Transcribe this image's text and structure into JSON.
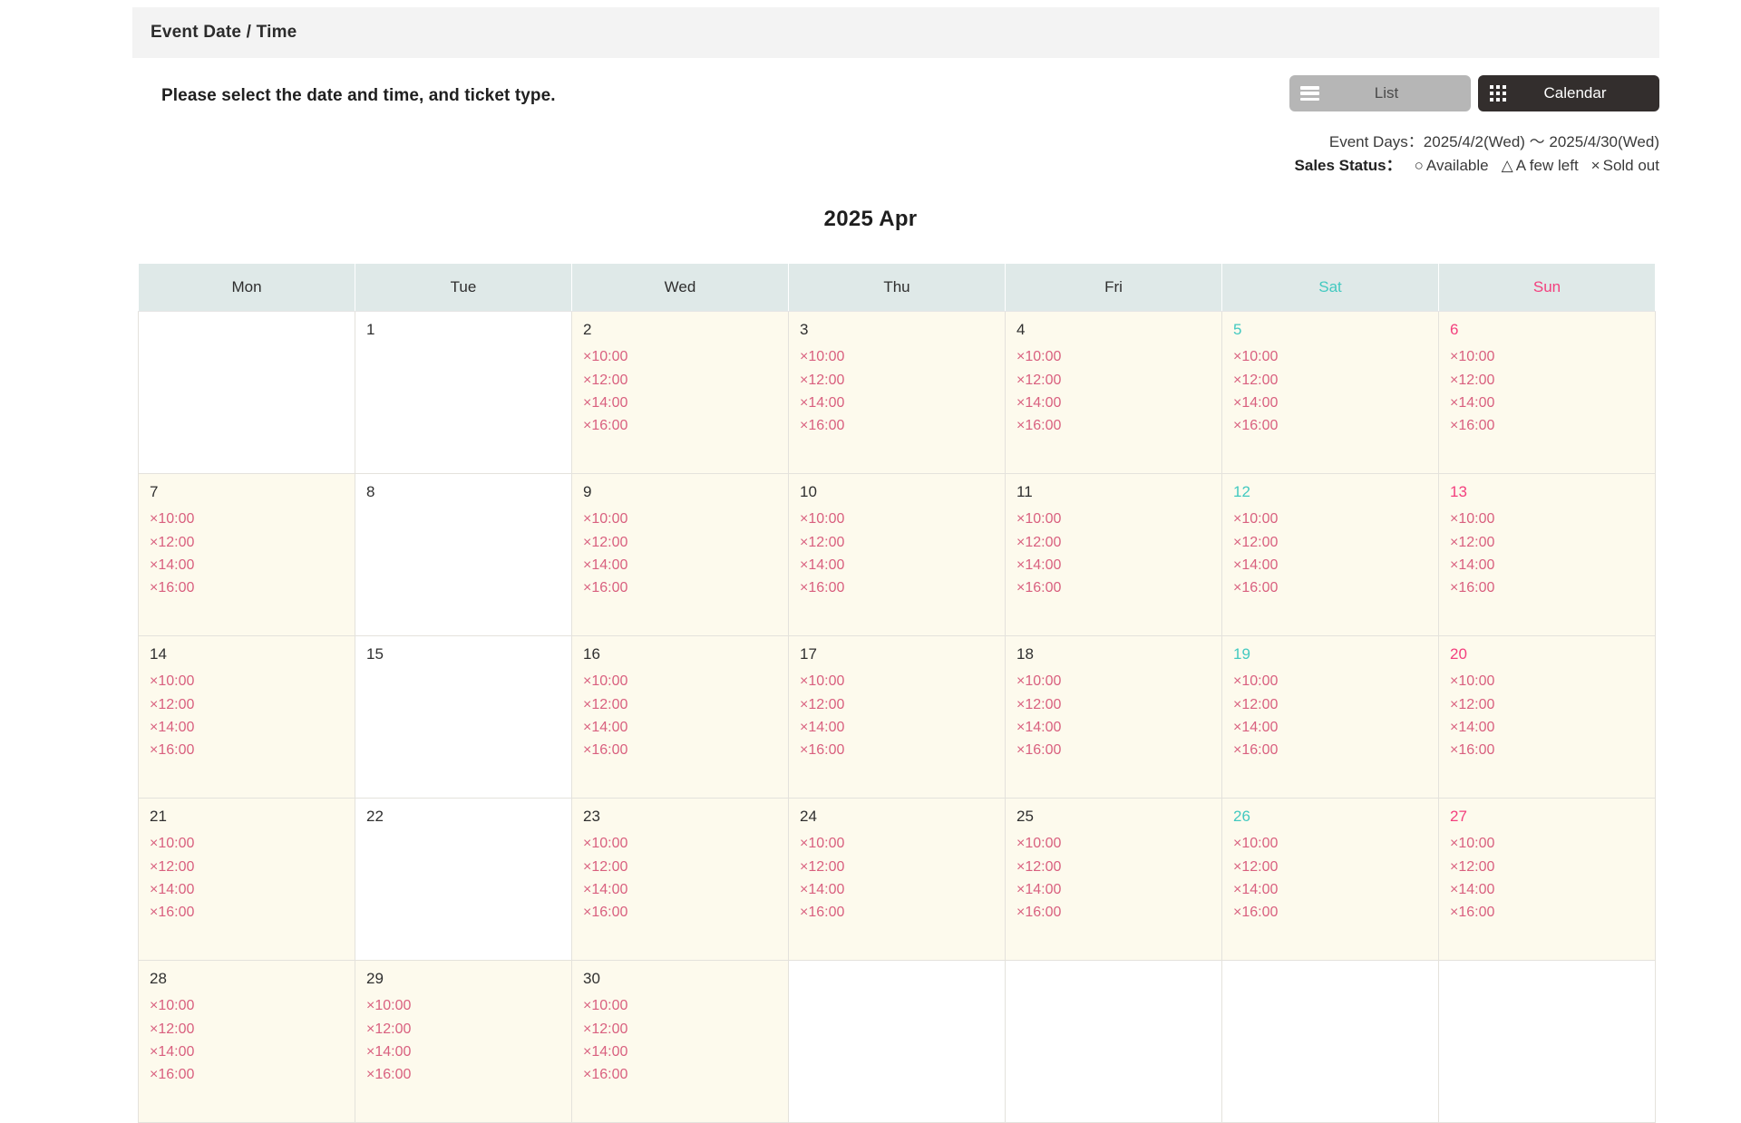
{
  "section": {
    "title": "Event Date / Time",
    "instruction": "Please select the date and time, and ticket type."
  },
  "view_toggle": {
    "list_label": "List",
    "calendar_label": "Calendar",
    "active": "Calendar",
    "list_icon": "hamburger-menu-icon",
    "calendar_icon": "grid-icon",
    "list_bg": "#b6b6b6",
    "calendar_bg": "#332e2d"
  },
  "meta": {
    "event_days_label": "Event Days",
    "event_days_separator": "：",
    "event_days_value": "2025/4/2(Wed) ～ 2025/4/30(Wed)",
    "sales_status_label": "Sales Status",
    "sales_status_separator": "：",
    "legend": [
      {
        "symbol": "○",
        "label": "Available"
      },
      {
        "symbol": "△",
        "label": "A few left"
      },
      {
        "symbol": "×",
        "label": "Sold out"
      }
    ]
  },
  "calendar": {
    "month_title": "2025 Apr",
    "weekdays": [
      {
        "label": "Mon",
        "kind": "weekday"
      },
      {
        "label": "Tue",
        "kind": "weekday"
      },
      {
        "label": "Wed",
        "kind": "weekday"
      },
      {
        "label": "Thu",
        "kind": "weekday"
      },
      {
        "label": "Fri",
        "kind": "weekday"
      },
      {
        "label": "Sat",
        "kind": "sat"
      },
      {
        "label": "Sun",
        "kind": "sun"
      }
    ],
    "slot_symbol": "×",
    "default_times": [
      "10:00",
      "12:00",
      "14:00",
      "16:00"
    ],
    "colors": {
      "header_bg": "#dfe9e8",
      "slot_day_bg": "#fdfaed",
      "closed_day_bg": "#ffffff",
      "sat_color": "#42c9c0",
      "sun_color": "#f3407e",
      "slot_color": "#d9607f"
    },
    "weeks": [
      [
        {
          "day": "",
          "kind": "blank",
          "slots": []
        },
        {
          "day": "1",
          "kind": "weekday",
          "slots": []
        },
        {
          "day": "2",
          "kind": "weekday",
          "slots": [
            "×10:00",
            "×12:00",
            "×14:00",
            "×16:00"
          ]
        },
        {
          "day": "3",
          "kind": "weekday",
          "slots": [
            "×10:00",
            "×12:00",
            "×14:00",
            "×16:00"
          ]
        },
        {
          "day": "4",
          "kind": "weekday",
          "slots": [
            "×10:00",
            "×12:00",
            "×14:00",
            "×16:00"
          ]
        },
        {
          "day": "5",
          "kind": "sat",
          "slots": [
            "×10:00",
            "×12:00",
            "×14:00",
            "×16:00"
          ]
        },
        {
          "day": "6",
          "kind": "sun",
          "slots": [
            "×10:00",
            "×12:00",
            "×14:00",
            "×16:00"
          ]
        }
      ],
      [
        {
          "day": "7",
          "kind": "weekday",
          "slots": [
            "×10:00",
            "×12:00",
            "×14:00",
            "×16:00"
          ]
        },
        {
          "day": "8",
          "kind": "weekday",
          "slots": []
        },
        {
          "day": "9",
          "kind": "weekday",
          "slots": [
            "×10:00",
            "×12:00",
            "×14:00",
            "×16:00"
          ]
        },
        {
          "day": "10",
          "kind": "weekday",
          "slots": [
            "×10:00",
            "×12:00",
            "×14:00",
            "×16:00"
          ]
        },
        {
          "day": "11",
          "kind": "weekday",
          "slots": [
            "×10:00",
            "×12:00",
            "×14:00",
            "×16:00"
          ]
        },
        {
          "day": "12",
          "kind": "sat",
          "slots": [
            "×10:00",
            "×12:00",
            "×14:00",
            "×16:00"
          ]
        },
        {
          "day": "13",
          "kind": "sun",
          "slots": [
            "×10:00",
            "×12:00",
            "×14:00",
            "×16:00"
          ]
        }
      ],
      [
        {
          "day": "14",
          "kind": "weekday",
          "slots": [
            "×10:00",
            "×12:00",
            "×14:00",
            "×16:00"
          ]
        },
        {
          "day": "15",
          "kind": "weekday",
          "slots": []
        },
        {
          "day": "16",
          "kind": "weekday",
          "slots": [
            "×10:00",
            "×12:00",
            "×14:00",
            "×16:00"
          ]
        },
        {
          "day": "17",
          "kind": "weekday",
          "slots": [
            "×10:00",
            "×12:00",
            "×14:00",
            "×16:00"
          ]
        },
        {
          "day": "18",
          "kind": "weekday",
          "slots": [
            "×10:00",
            "×12:00",
            "×14:00",
            "×16:00"
          ]
        },
        {
          "day": "19",
          "kind": "sat",
          "slots": [
            "×10:00",
            "×12:00",
            "×14:00",
            "×16:00"
          ]
        },
        {
          "day": "20",
          "kind": "sun",
          "slots": [
            "×10:00",
            "×12:00",
            "×14:00",
            "×16:00"
          ]
        }
      ],
      [
        {
          "day": "21",
          "kind": "weekday",
          "slots": [
            "×10:00",
            "×12:00",
            "×14:00",
            "×16:00"
          ]
        },
        {
          "day": "22",
          "kind": "weekday",
          "slots": []
        },
        {
          "day": "23",
          "kind": "weekday",
          "slots": [
            "×10:00",
            "×12:00",
            "×14:00",
            "×16:00"
          ]
        },
        {
          "day": "24",
          "kind": "weekday",
          "slots": [
            "×10:00",
            "×12:00",
            "×14:00",
            "×16:00"
          ]
        },
        {
          "day": "25",
          "kind": "weekday",
          "slots": [
            "×10:00",
            "×12:00",
            "×14:00",
            "×16:00"
          ]
        },
        {
          "day": "26",
          "kind": "sat",
          "slots": [
            "×10:00",
            "×12:00",
            "×14:00",
            "×16:00"
          ]
        },
        {
          "day": "27",
          "kind": "sun",
          "slots": [
            "×10:00",
            "×12:00",
            "×14:00",
            "×16:00"
          ]
        }
      ],
      [
        {
          "day": "28",
          "kind": "weekday",
          "slots": [
            "×10:00",
            "×12:00",
            "×14:00",
            "×16:00"
          ]
        },
        {
          "day": "29",
          "kind": "weekday",
          "slots": [
            "×10:00",
            "×12:00",
            "×14:00",
            "×16:00"
          ]
        },
        {
          "day": "30",
          "kind": "weekday",
          "slots": [
            "×10:00",
            "×12:00",
            "×14:00",
            "×16:00"
          ]
        },
        {
          "day": "",
          "kind": "blank",
          "slots": []
        },
        {
          "day": "",
          "kind": "blank",
          "slots": []
        },
        {
          "day": "",
          "kind": "blank",
          "slots": []
        },
        {
          "day": "",
          "kind": "blank",
          "slots": []
        }
      ]
    ]
  }
}
